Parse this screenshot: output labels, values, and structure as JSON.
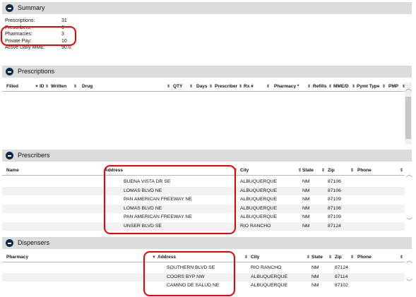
{
  "summary": {
    "title": "Summary",
    "rows": [
      {
        "label": "Prescriptions:",
        "value": "31"
      },
      {
        "label": "Prescribers:",
        "value": "6"
      },
      {
        "label": "Pharmacies:",
        "value": "3"
      },
      {
        "label": "Private Pay:",
        "value": "10"
      },
      {
        "label": "Active Daily MME:",
        "value": "90.0"
      }
    ]
  },
  "prescriptions": {
    "title": "Prescriptions",
    "columns": [
      "Filled",
      "ID",
      "Written",
      "Drug",
      "QTY",
      "Days",
      "Prescriber",
      "Rx #",
      "Pharmacy *",
      "Refills",
      "MME/D",
      "Pymt Type",
      "PMP"
    ]
  },
  "prescribers": {
    "title": "Prescribers",
    "columns": [
      "Name",
      "Address",
      "City",
      "State",
      "Zip",
      "Phone"
    ],
    "rows": [
      {
        "address": "BUENA VISTA DR SE",
        "city": "ALBUQUERQUE",
        "state": "NM",
        "zip": "87106"
      },
      {
        "address": "LOMAS BLVD NE",
        "city": "ALBUQUERQUE",
        "state": "NM",
        "zip": "87106"
      },
      {
        "address": "PAN AMERICAN FREEWAY NE",
        "city": "ALBUQUERQUE",
        "state": "NM",
        "zip": "87109"
      },
      {
        "address": "LOMAS BLVD NE",
        "city": "ALBUQUERQUE",
        "state": "NM",
        "zip": "87106"
      },
      {
        "address": "PAN AMERICAN FREEWAY NE",
        "city": "ALBUQUERQUE",
        "state": "NM",
        "zip": "87109"
      },
      {
        "address": "UNSER BLVD SE",
        "city": "RIO RANCHO",
        "state": "NM",
        "zip": "87124"
      }
    ]
  },
  "dispensers": {
    "title": "Dispensers",
    "columns": [
      "Pharmacy",
      "Address",
      "City",
      "State",
      "Zip",
      "Phone"
    ],
    "rows": [
      {
        "address": "SOUTHERN BLVD SE",
        "city": "RIO RANCHO",
        "state": "NM",
        "zip": "87124"
      },
      {
        "address": "COORS BYP NW",
        "city": "ALBUQUERQUE",
        "state": "NM",
        "zip": "87114"
      },
      {
        "address": "CAMINO DE SALUD NE",
        "city": "ALBUQUERQUE",
        "state": "NM",
        "zip": "87102"
      }
    ]
  },
  "icons": {
    "collapse": "minus-circle-icon",
    "sort": "sort-arrows-icon",
    "scroll_up": "chevron-up-icon",
    "scroll_down": "chevron-down-icon"
  },
  "colors": {
    "header_bg": "#dcdcdc",
    "highlight": "#e00000",
    "collapse_icon": "#0b2a4a"
  }
}
